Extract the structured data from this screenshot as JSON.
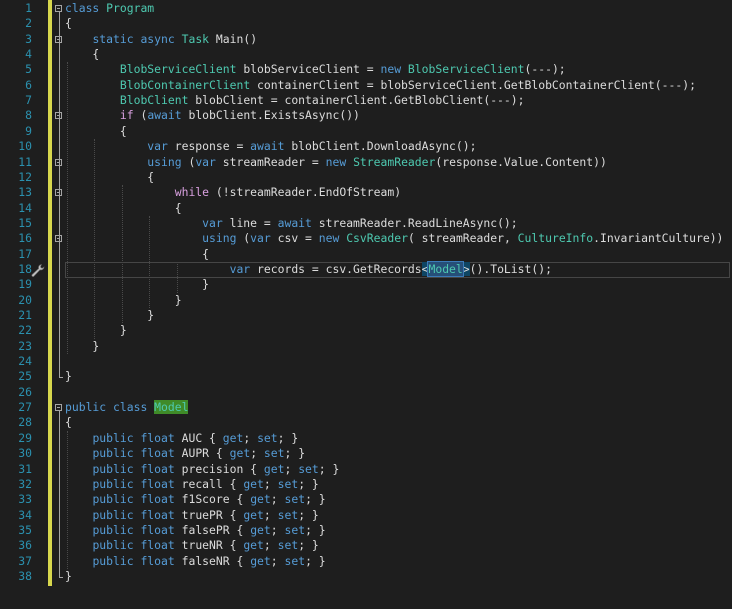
{
  "editor": {
    "line_numbers": [
      "1",
      "2",
      "3",
      "4",
      "5",
      "6",
      "7",
      "8",
      "9",
      "10",
      "11",
      "12",
      "13",
      "14",
      "15",
      "16",
      "17",
      "18",
      "19",
      "20",
      "21",
      "22",
      "23",
      "24",
      "25",
      "26",
      "27",
      "28",
      "29",
      "30",
      "31",
      "32",
      "33",
      "34",
      "35",
      "36",
      "37",
      "38"
    ],
    "lines": [
      "class Program",
      "{",
      "    static async Task Main()",
      "    {",
      "        BlobServiceClient blobServiceClient = new BlobServiceClient(---);",
      "        BlobContainerClient containerClient = blobServiceClient.GetBlobContainerClient(---);",
      "        BlobClient blobClient = containerClient.GetBlobClient(---);",
      "        if (await blobClient.ExistsAsync())",
      "        {",
      "            var response = await blobClient.DownloadAsync();",
      "            using (var streamReader = new StreamReader(response.Value.Content))",
      "            {",
      "                while (!streamReader.EndOfStream)",
      "                {",
      "                    var line = await streamReader.ReadLineAsync();",
      "                    using (var csv = new CsvReader( streamReader, CultureInfo.InvariantCulture))",
      "                    {",
      "                        var records = csv.GetRecords<Model>().ToList();",
      "                    }",
      "                }",
      "            }",
      "        }",
      "    }",
      "",
      "}",
      "",
      "public class Model",
      "{",
      "    public float AUC { get; set; }",
      "    public float AUPR { get; set; }",
      "    public float precision { get; set; }",
      "    public float recall { get; set; }",
      "    public float f1Score { get; set; }",
      "    public float truePR { get; set; }",
      "    public float falsePR { get; set; }",
      "    public float trueNR { get; set; }",
      "    public float falseNR { get; set; }",
      "}"
    ],
    "current_line": 18
  },
  "colors": {
    "background": "#1e1e1e",
    "line_number": "#2b91af",
    "keyword": "#569cd6",
    "control_keyword": "#d8a0df",
    "type": "#4ec9b0",
    "text": "#dcdcdc",
    "change_bar": "#d7d74d"
  },
  "icons": {
    "quick_action": "wrench-icon"
  }
}
